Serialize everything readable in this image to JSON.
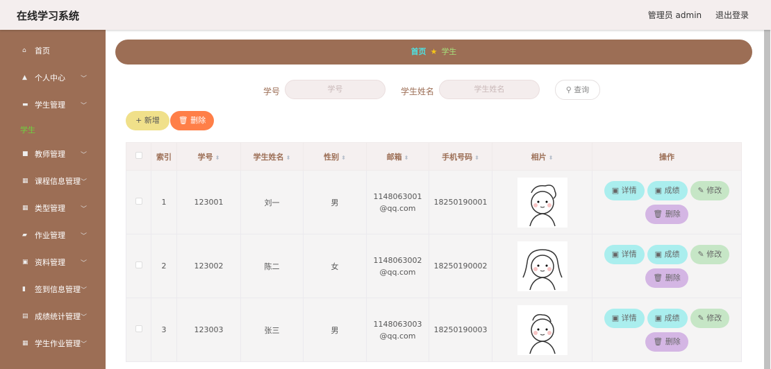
{
  "header": {
    "title": "在线学习系统",
    "user": "管理员 admin",
    "logout": "退出登录"
  },
  "sidebar": {
    "items": [
      {
        "label": "首页",
        "icon": "home-icon",
        "ic": "⌂",
        "chev": false
      },
      {
        "label": "个人中心",
        "icon": "user-icon",
        "ic": "▲",
        "chev": true
      },
      {
        "label": "学生管理",
        "icon": "chat-icon",
        "ic": "▬",
        "chev": true
      },
      {
        "label": "教师管理",
        "icon": "monitor-icon",
        "ic": "■",
        "chev": true
      },
      {
        "label": "课程信息管理",
        "icon": "grid-icon",
        "ic": "▦",
        "chev": true
      },
      {
        "label": "类型管理",
        "icon": "grid-icon",
        "ic": "▦",
        "chev": true
      },
      {
        "label": "作业管理",
        "icon": "briefcase-icon",
        "ic": "▰",
        "chev": true
      },
      {
        "label": "资料管理",
        "icon": "clipboard-icon",
        "ic": "▣",
        "chev": true
      },
      {
        "label": "签到信息管理",
        "icon": "book-icon",
        "ic": "▮",
        "chev": true
      },
      {
        "label": "成绩统计管理",
        "icon": "document-icon",
        "ic": "▤",
        "chev": true
      },
      {
        "label": "学生作业管理",
        "icon": "grid-icon",
        "ic": "▦",
        "chev": true
      }
    ],
    "active_sub": "学生"
  },
  "breadcrumb": {
    "home": "首页",
    "current": "学生"
  },
  "search": {
    "id_label": "学号",
    "id_placeholder": "学号",
    "name_label": "学生姓名",
    "name_placeholder": "学生姓名",
    "query": "查询"
  },
  "actions": {
    "add": "新增",
    "delete": "删除"
  },
  "table": {
    "headers": [
      "索引",
      "学号",
      "学生姓名",
      "性别",
      "邮箱",
      "手机号码",
      "相片",
      "操作"
    ],
    "rows": [
      {
        "index": "1",
        "id": "123001",
        "name": "刘一",
        "gender": "男",
        "email": "1148063001@qq.com",
        "phone": "18250190001"
      },
      {
        "index": "2",
        "id": "123002",
        "name": "陈二",
        "gender": "女",
        "email": "1148063002@qq.com",
        "phone": "18250190002"
      },
      {
        "index": "3",
        "id": "123003",
        "name": "张三",
        "gender": "男",
        "email": "1148063003@qq.com",
        "phone": "18250190003"
      }
    ],
    "row_actions": {
      "detail": "详情",
      "score": "成绩",
      "edit": "修改",
      "delete": "删除"
    }
  }
}
